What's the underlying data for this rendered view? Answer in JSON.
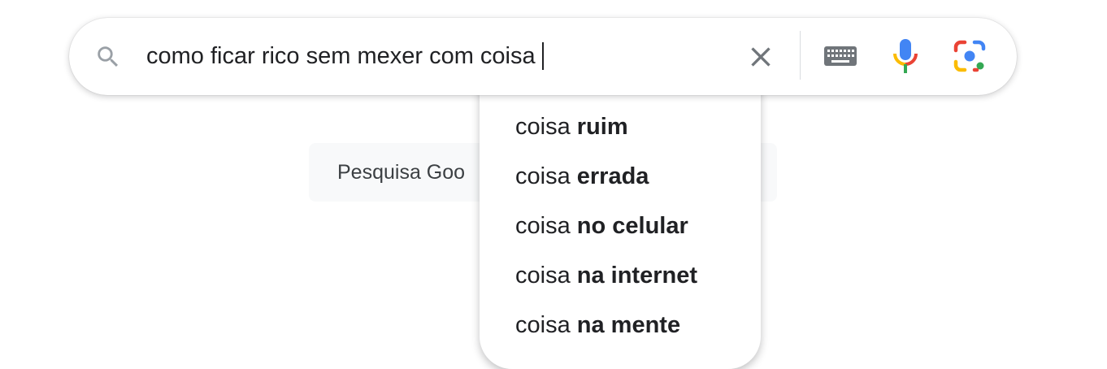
{
  "search": {
    "query": "como ficar rico sem mexer com coisa"
  },
  "buttons": {
    "google_search_label": "Pesquisa Goo"
  },
  "suggestions": [
    {
      "prefix": "coisa ",
      "completion": "ruim"
    },
    {
      "prefix": "coisa ",
      "completion": "errada"
    },
    {
      "prefix": "coisa ",
      "completion": "no celular"
    },
    {
      "prefix": "coisa ",
      "completion": "na internet"
    },
    {
      "prefix": "coisa ",
      "completion": "na mente"
    }
  ],
  "icons": {
    "search": "search-icon",
    "clear": "close-icon",
    "keyboard": "keyboard-icon",
    "voice": "microphone-icon",
    "lens": "camera-lens-icon"
  },
  "colors": {
    "google_blue": "#4285F4",
    "google_red": "#EA4335",
    "google_yellow": "#FBBC04",
    "google_green": "#34A853",
    "icon_gray": "#70757a"
  }
}
